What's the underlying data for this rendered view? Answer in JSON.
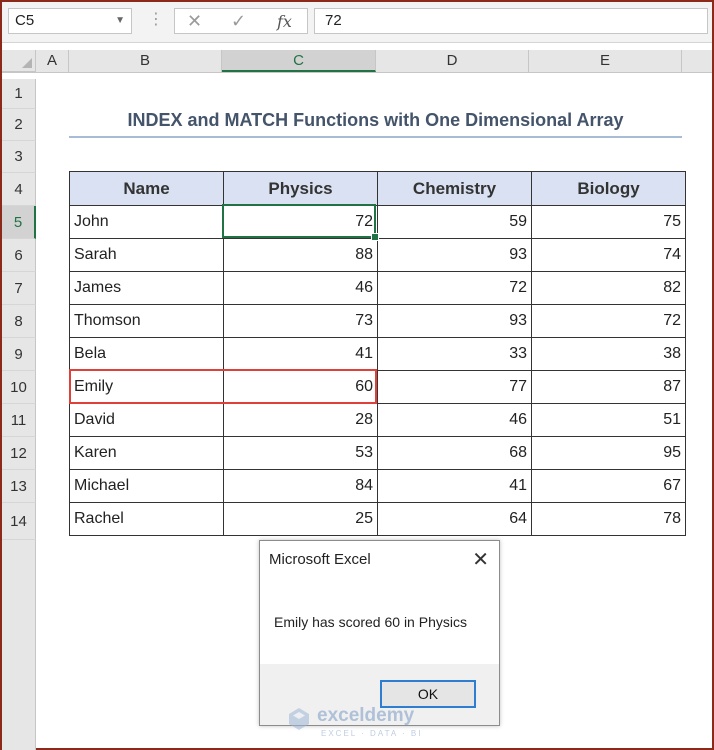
{
  "formula_bar": {
    "name_box": "C5",
    "formula": "72"
  },
  "columns": [
    "A",
    "B",
    "C",
    "D",
    "E"
  ],
  "rows": [
    "1",
    "2",
    "3",
    "4",
    "5",
    "6",
    "7",
    "8",
    "9",
    "10",
    "11",
    "12",
    "13",
    "14"
  ],
  "active_cell": {
    "column": "C",
    "row": "5"
  },
  "sheet": {
    "title": "INDEX and MATCH Functions with One Dimensional Array",
    "headers": [
      "Name",
      "Physics",
      "Chemistry",
      "Biology"
    ],
    "records": [
      [
        "John",
        "72",
        "59",
        "75"
      ],
      [
        "Sarah",
        "88",
        "93",
        "74"
      ],
      [
        "James",
        "46",
        "72",
        "82"
      ],
      [
        "Thomson",
        "73",
        "93",
        "72"
      ],
      [
        "Bela",
        "41",
        "33",
        "38"
      ],
      [
        "Emily",
        "60",
        "77",
        "87"
      ],
      [
        "David",
        "28",
        "46",
        "51"
      ],
      [
        "Karen",
        "53",
        "68",
        "95"
      ],
      [
        "Michael",
        "84",
        "41",
        "67"
      ],
      [
        "Rachel",
        "25",
        "64",
        "78"
      ]
    ],
    "highlighted_record": "Emily"
  },
  "dialog": {
    "title": "Microsoft Excel",
    "message": "Emily has scored 60 in Physics",
    "ok_label": "OK"
  },
  "watermark": {
    "name": "exceldemy",
    "tagline": "EXCEL · DATA · BI"
  },
  "colors": {
    "excel_green": "#217346",
    "header_fill": "#d9e1f2",
    "highlight": "#e0403a",
    "title_text": "#44546a"
  }
}
